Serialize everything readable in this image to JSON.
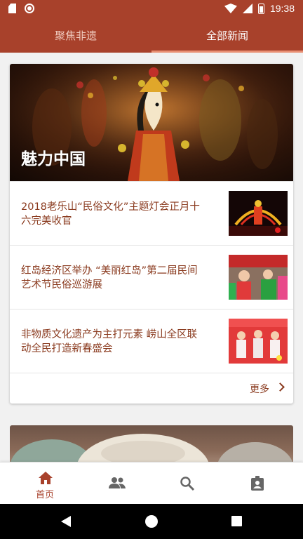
{
  "status_bar": {
    "time": "19:38"
  },
  "tabs": [
    {
      "label": "聚焦非遗",
      "selected": false
    },
    {
      "label": "全部新闻",
      "selected": true
    }
  ],
  "section": {
    "title": "魅力中国",
    "items": [
      {
        "title": "2018老乐山“民俗文化”主题灯会正月十六完美收官"
      },
      {
        "title": "红岛经济区举办 “美丽红岛”第二届民间艺术节民俗巡游展"
      },
      {
        "title": "非物质文化遗产为主打元素 崂山全区联动全民打造新春盛会"
      }
    ],
    "more_label": "更多"
  },
  "bottom_nav": [
    {
      "label": "首页",
      "icon": "home-icon",
      "active": true
    },
    {
      "label": "",
      "icon": "people-icon",
      "active": false
    },
    {
      "label": "",
      "icon": "search-icon",
      "active": false
    },
    {
      "label": "",
      "icon": "contact-badge-icon",
      "active": false
    }
  ],
  "colors": {
    "primary": "#a8412b",
    "tab_indicator": "#e98f73",
    "text_title": "#8a3a1e",
    "nav_inactive": "#666666"
  }
}
